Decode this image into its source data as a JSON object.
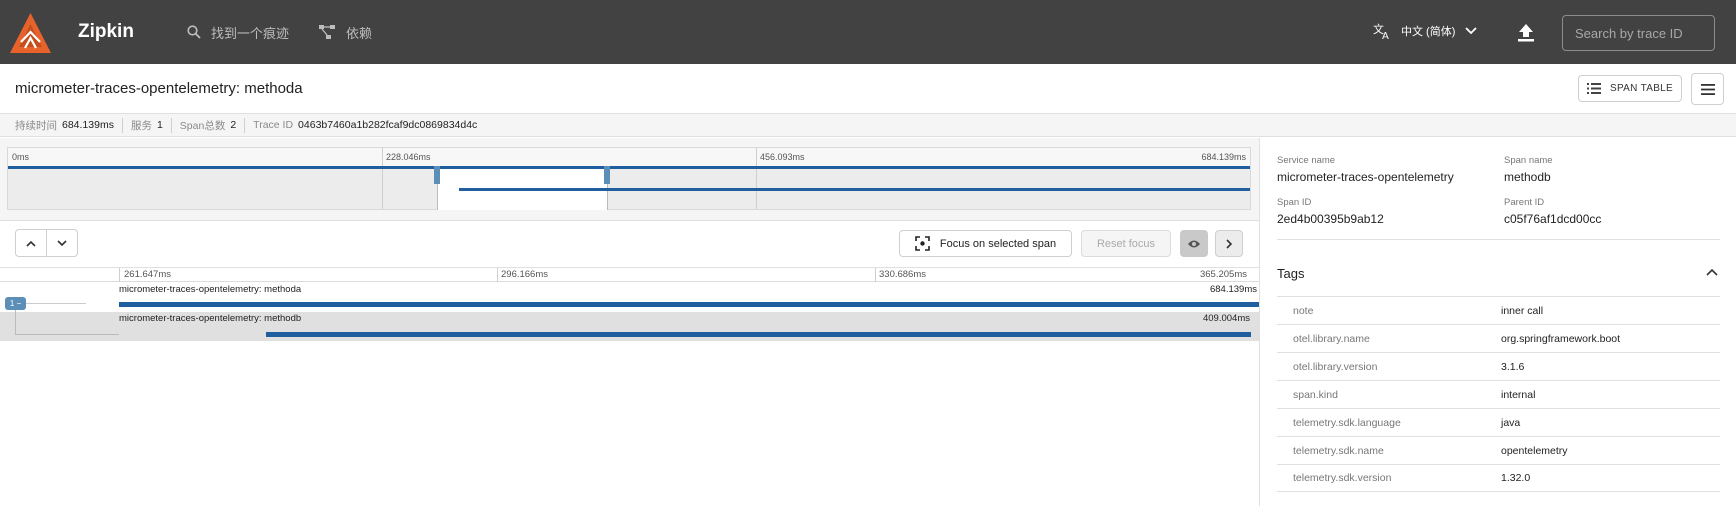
{
  "app": {
    "brand": "Zipkin",
    "nav": {
      "find_trace": "找到一个痕迹",
      "dependencies": "依赖"
    },
    "language": "中文 (简体)",
    "search": {
      "placeholder": "Search by trace ID"
    }
  },
  "trace": {
    "title": "micrometer-traces-opentelemetry: methoda",
    "span_table_label": "SPAN TABLE",
    "stats": [
      {
        "key": "持续时间",
        "value": "684.139ms"
      },
      {
        "key": "服务",
        "value": "1"
      },
      {
        "key": "Span总数",
        "value": "2"
      },
      {
        "key": "Trace ID",
        "value": "0463b7460a1b282fcaf9dc0869834d4c"
      }
    ]
  },
  "minimap": {
    "labels": [
      "0ms",
      "228.046ms",
      "456.093ms",
      "684.139ms"
    ]
  },
  "controls": {
    "focus_label": "Focus on selected span",
    "reset_label": "Reset focus"
  },
  "timeline": {
    "labels": [
      "261.647ms",
      "296.166ms",
      "330.686ms",
      "365.205ms"
    ],
    "spans": [
      {
        "name": "micrometer-traces-opentelemetry: methoda",
        "duration": "684.139ms",
        "badge": "1 −"
      },
      {
        "name": "micrometer-traces-opentelemetry: methodb",
        "duration": "409.004ms"
      }
    ]
  },
  "detail": {
    "service_name_label": "Service name",
    "service_name": "micrometer-traces-opentelemetry",
    "span_name_label": "Span name",
    "span_name": "methodb",
    "span_id_label": "Span ID",
    "span_id": "2ed4b00395b9ab12",
    "parent_id_label": "Parent ID",
    "parent_id": "c05f76af1dcd00cc",
    "tags_title": "Tags",
    "tags": [
      {
        "key": "note",
        "value": "inner call"
      },
      {
        "key": "otel.library.name",
        "value": "org.springframework.boot"
      },
      {
        "key": "otel.library.version",
        "value": "3.1.6"
      },
      {
        "key": "span.kind",
        "value": "internal"
      },
      {
        "key": "telemetry.sdk.language",
        "value": "java"
      },
      {
        "key": "telemetry.sdk.name",
        "value": "opentelemetry"
      },
      {
        "key": "telemetry.sdk.version",
        "value": "1.32.0"
      }
    ]
  },
  "colors": {
    "header_bg": "#424242",
    "logo_orange": "#e8632b",
    "span_bar": "#1f5f9f",
    "handle": "#5b8fb8"
  }
}
